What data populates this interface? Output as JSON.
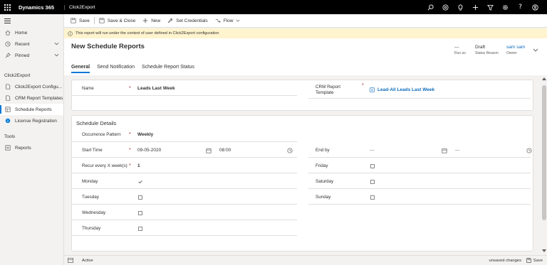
{
  "topbar": {
    "brand": "Dynamics 365",
    "app": "Click2Export",
    "icons": [
      "search-icon",
      "target-icon",
      "lightbulb-icon",
      "plus-icon",
      "filter-icon",
      "gear-icon",
      "help-icon",
      "user-icon"
    ]
  },
  "sidebar": {
    "items": [
      {
        "label": "Home",
        "icon": "home-icon"
      },
      {
        "label": "Recent",
        "icon": "clock-icon"
      },
      {
        "label": "Pinned",
        "icon": "pin-icon"
      }
    ],
    "group1": "Click2Export",
    "group1_items": [
      {
        "label": "Click2Export Configu...",
        "icon": "document-icon"
      },
      {
        "label": "CRM Report Templates",
        "icon": "document-icon"
      },
      {
        "label": "Schedule Reports",
        "icon": "grid-icon"
      },
      {
        "label": "License Registration",
        "icon": "info-icon"
      }
    ],
    "group2": "Tools",
    "group2_items": [
      {
        "label": "Reports",
        "icon": "report-icon"
      }
    ]
  },
  "commands": {
    "save": "Save",
    "save_close": "Save & Close",
    "new": "New",
    "set_credentials": "Set Credentials",
    "flow": "Flow"
  },
  "notice": "This report will run under the context of user defined in Click2Export configuration",
  "header": {
    "title": "New Schedule Reports",
    "run_as_value": "---",
    "run_as_label": "Run as",
    "status_value": "Draft",
    "status_label": "Status Reason",
    "owner_value": "sam sam",
    "owner_label": "Owner"
  },
  "tabs": [
    "General",
    "Send Notification",
    "Schedule Report Status"
  ],
  "general": {
    "name_label": "Name",
    "name_value": "Leads Last Week",
    "template_label_1": "CRM Report",
    "template_label_2": "Template",
    "template_value": "Lead-All Leads Last Week"
  },
  "schedule": {
    "title": "Schedule Details",
    "occurrence_label": "Occurrence Pattern",
    "occurrence_value": "Weekly",
    "start_label": "Start Time",
    "start_date": "09-05-2020",
    "start_time": "08:00",
    "end_label": "End by",
    "end_date": "---",
    "end_time": "---",
    "recur_label": "Recur every X week(s)",
    "recur_value": "1",
    "days": [
      {
        "label": "Monday",
        "checked": true
      },
      {
        "label": "Tuesday",
        "checked": false
      },
      {
        "label": "Wednesday",
        "checked": false
      },
      {
        "label": "Thursday",
        "checked": false
      },
      {
        "label": "Friday",
        "checked": false
      },
      {
        "label": "Saturday",
        "checked": false
      },
      {
        "label": "Sunday",
        "checked": false
      }
    ]
  },
  "footer": {
    "status": "Active",
    "unsaved": "unsaved changes",
    "save": "Save"
  },
  "colors": {
    "accent": "#0078d4",
    "link": "#0f6cbd",
    "notice_bg": "#fff4ce",
    "required": "#a4262c"
  }
}
